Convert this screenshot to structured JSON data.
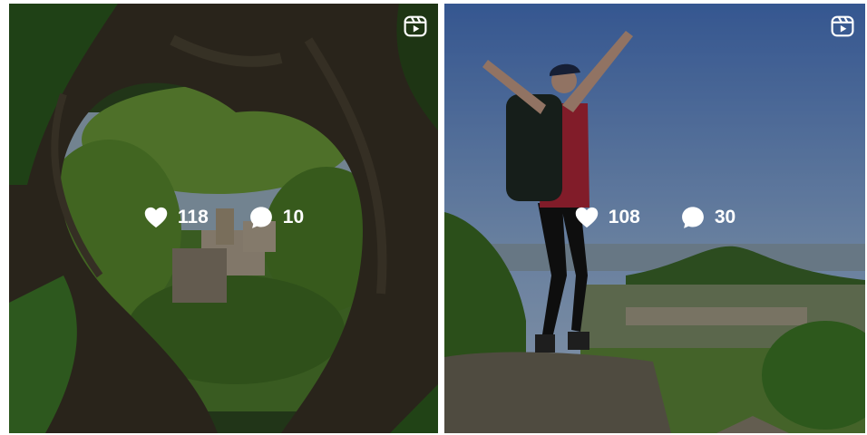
{
  "posts": [
    {
      "type_icon": "reel-icon",
      "likes": "118",
      "comments": "10",
      "like_icon": "heart-icon",
      "comment_icon": "comment-bubble-icon"
    },
    {
      "type_icon": "reel-icon",
      "likes": "108",
      "comments": "30",
      "like_icon": "heart-icon",
      "comment_icon": "comment-bubble-icon"
    }
  ],
  "colors": {
    "overlay": "#000000",
    "stat_text": "#ffffff",
    "frame_green": "#2e6b2a"
  }
}
